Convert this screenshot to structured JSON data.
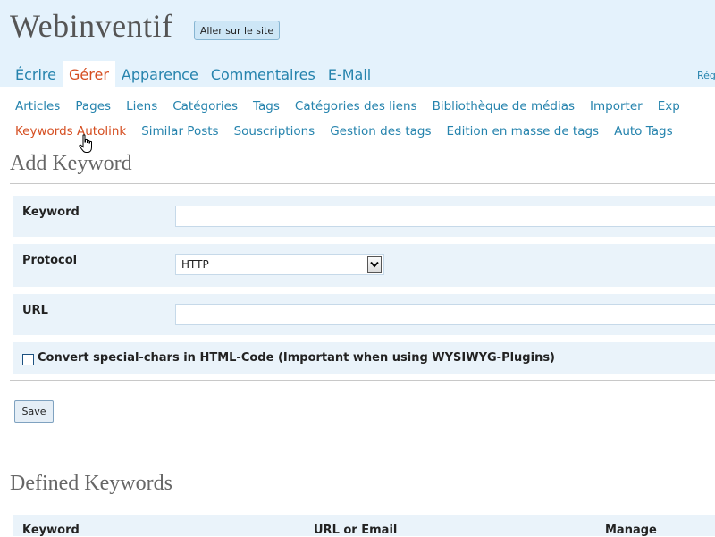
{
  "header": {
    "site_title": "Webinventif",
    "visit_site_label": "Aller sur le site",
    "right_text": "Rég"
  },
  "main_nav": [
    {
      "label": "Écrire",
      "current": false
    },
    {
      "label": "Gérer",
      "current": true
    },
    {
      "label": "Apparence",
      "current": false
    },
    {
      "label": "Commentaires",
      "current": false
    },
    {
      "label": "E-Mail",
      "current": false
    }
  ],
  "sub_nav_row1": [
    "Articles",
    "Pages",
    "Liens",
    "Catégories",
    "Tags",
    "Catégories des liens",
    "Bibliothèque de médias",
    "Importer",
    "Exp"
  ],
  "sub_nav_row2": [
    "Keywords Autolink",
    "Similar Posts",
    "Souscriptions",
    "Gestion des tags",
    "Edition en masse de tags",
    "Auto Tags"
  ],
  "add_keyword": {
    "title": "Add Keyword",
    "keyword_label": "Keyword",
    "keyword_value": "",
    "protocol_label": "Protocol",
    "protocol_selected": "HTTP",
    "url_label": "URL",
    "url_value": "",
    "convert_label": "Convert special-chars in HTML-Code (Important when using WYSIWYG-Plugins)",
    "convert_checked": false,
    "save_label": "Save"
  },
  "defined_keywords": {
    "title": "Defined Keywords",
    "columns": [
      "Keyword",
      "URL or Email",
      "Manage"
    ]
  },
  "colors": {
    "header_bg": "#e4f2fc",
    "link": "#2583ad",
    "current": "#d54e21",
    "row_bg": "#eaf3fa"
  },
  "icons": [
    "hand-pointer-icon",
    "chevron-down-icon"
  ]
}
